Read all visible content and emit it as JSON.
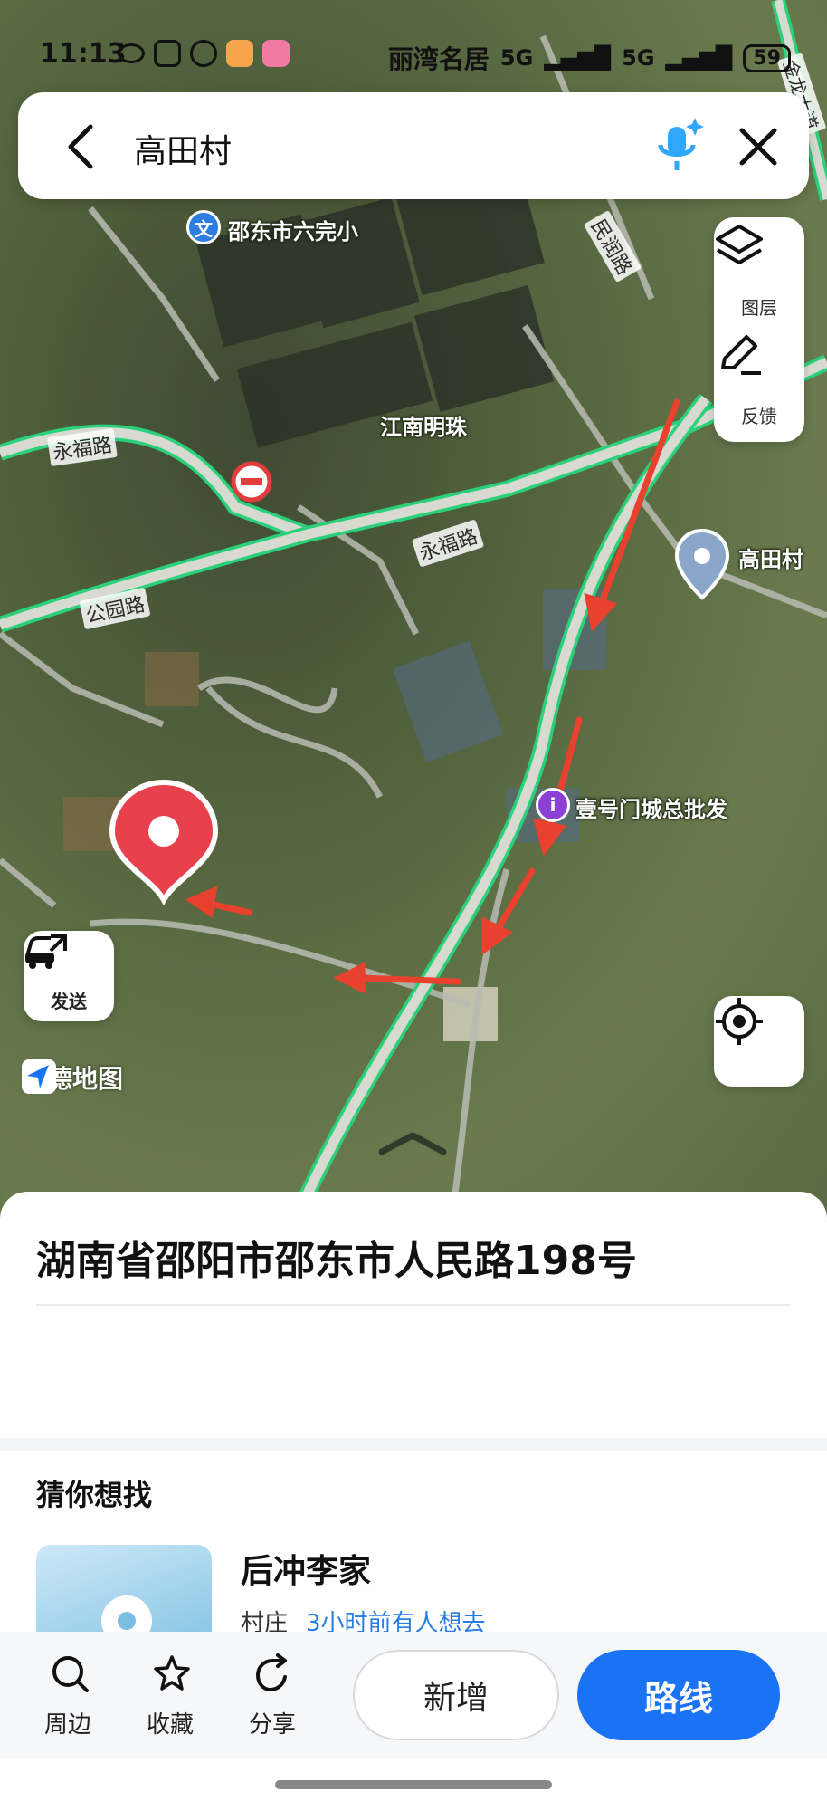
{
  "status_bar": {
    "time": "11:13",
    "network": "5G",
    "network_2": "5G",
    "battery": "59",
    "carrier_text": "丽湾名居"
  },
  "search": {
    "query": "高田村"
  },
  "map": {
    "labels": {
      "school": "邵东市六完小",
      "estate": "江南明珠",
      "road_yongfu_1": "永福路",
      "road_yongfu_2": "永福路",
      "road_gongyuan": "公园路",
      "road_minsheng": "民润路",
      "road_jinlong": "金龙大道",
      "village": "高田村",
      "market": "壹号门城总批发"
    },
    "tools": {
      "layers": "图层",
      "feedback": "反馈"
    },
    "send": "发送",
    "brand": "高德地图",
    "icons": {
      "layers": "layers-icon",
      "feedback": "pencil-icon",
      "locate": "locate-icon",
      "send": "car-send-icon"
    }
  },
  "sheet": {
    "address": "湖南省邵阳市邵东市人民路198号",
    "section_title": "猜你想找",
    "suggestion": {
      "name": "后冲李家",
      "type": "村庄",
      "hint": "3小时前有人想去"
    }
  },
  "actions": {
    "nearby": "周边",
    "favorite": "收藏",
    "share": "分享",
    "add": "新增",
    "route": "路线"
  },
  "colors": {
    "accent": "#1a73f5",
    "pin": "#e8414d",
    "arrow": "#e8412e",
    "route_green": "#2ad17a"
  }
}
